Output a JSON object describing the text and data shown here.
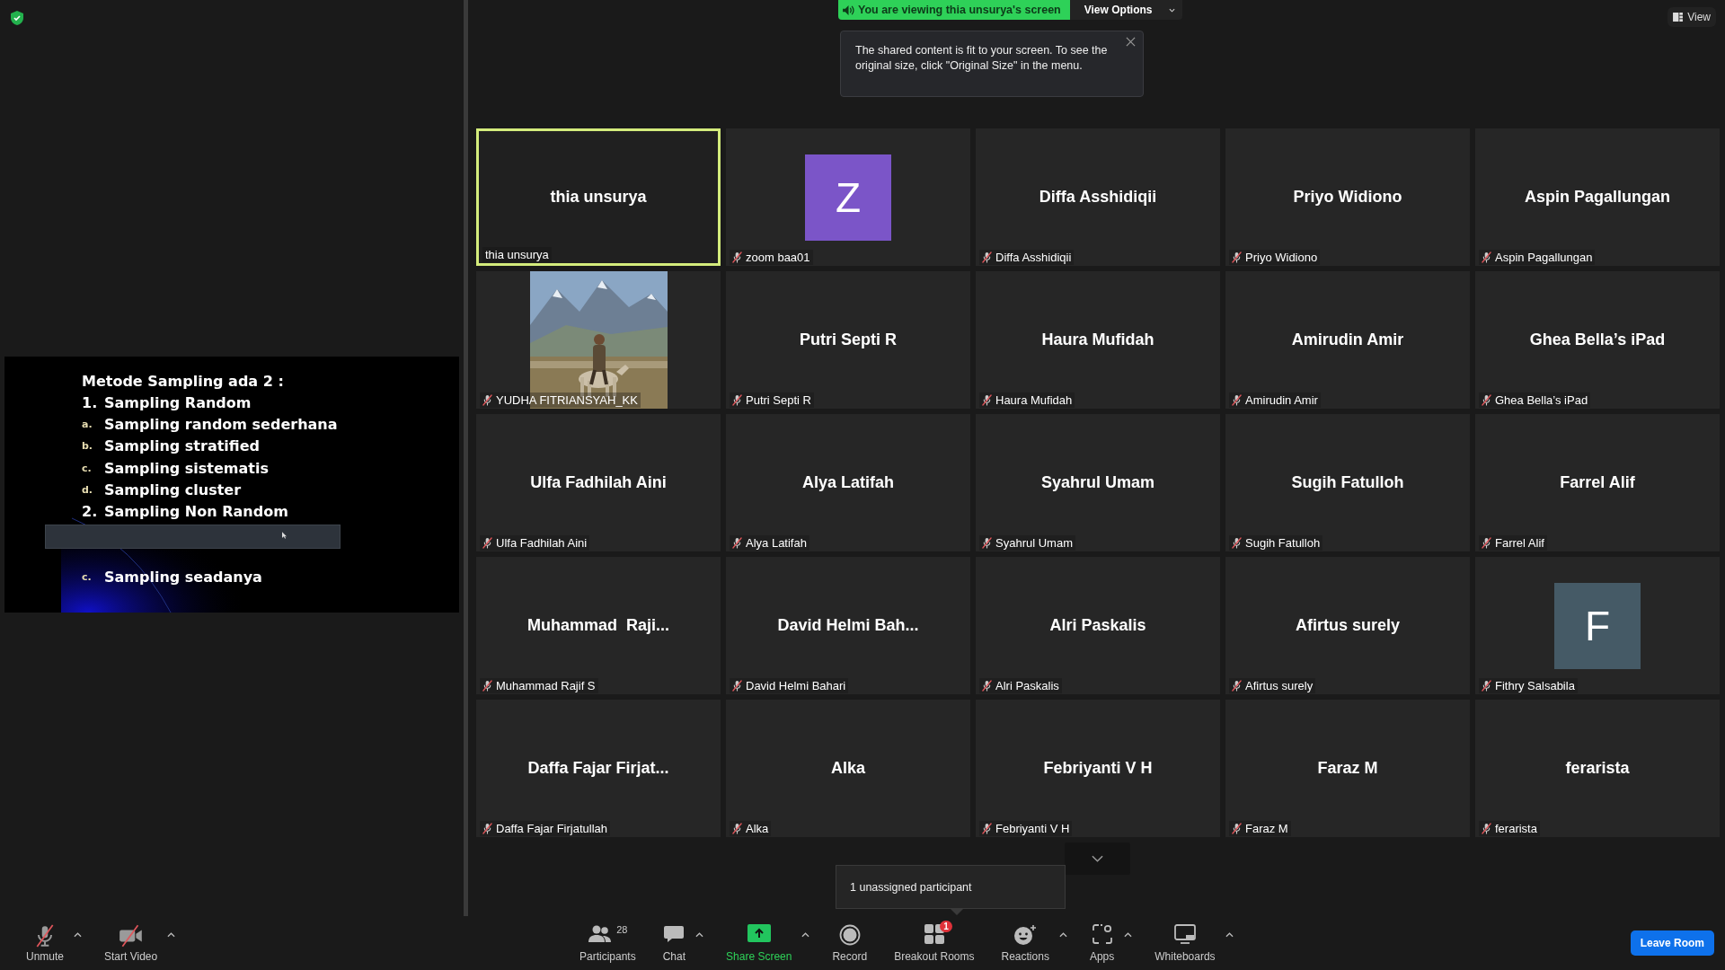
{
  "banner": {
    "text": "You are viewing thia unsurya's screen",
    "options_button": "View Options"
  },
  "tooltip": {
    "text": "The shared content is fit to your screen. To see the original size, click \"Original Size\" in the menu."
  },
  "view_button": {
    "label": "View"
  },
  "slide": {
    "title": "Metode Sampling ada 2 :",
    "items": [
      {
        "kind": "number",
        "marker": "1.",
        "text": "Sampling Random"
      },
      {
        "kind": "letter",
        "marker": "a.",
        "text": "Sampling random sederhana"
      },
      {
        "kind": "letter",
        "marker": "b.",
        "text": "Sampling stratified"
      },
      {
        "kind": "letter",
        "marker": "c.",
        "text": "Sampling sistematis"
      },
      {
        "kind": "letter",
        "marker": "d.",
        "text": "Sampling cluster"
      },
      {
        "kind": "number",
        "marker": "2.",
        "text": "Sampling Non Random"
      },
      {
        "kind": "covered"
      },
      {
        "kind": "letter",
        "marker": "c.",
        "text": "Sampling seadanya"
      }
    ]
  },
  "participants": [
    {
      "kind": "name",
      "display": "thia unsurya",
      "label": "thia unsurya",
      "muted": false,
      "speaking": true
    },
    {
      "kind": "avatar",
      "letter": "Z",
      "color": "#7b55c8",
      "label": "zoom baa01",
      "muted": true,
      "speaking": false
    },
    {
      "kind": "name",
      "display": "Diffa Asshidiqii",
      "label": "Diffa Asshidiqii",
      "muted": true,
      "speaking": false
    },
    {
      "kind": "name",
      "display": "Priyo Widiono",
      "label": "Priyo Widiono",
      "muted": true,
      "speaking": false
    },
    {
      "kind": "name",
      "display": "Aspin Pagallungan",
      "label": "Aspin Pagallungan",
      "muted": true,
      "speaking": false
    },
    {
      "kind": "picture",
      "label": "YUDHA FITRIANSYAH_KK",
      "muted": true,
      "speaking": false
    },
    {
      "kind": "name",
      "display": "Putri Septi R",
      "label": "Putri Septi R",
      "muted": true,
      "speaking": false
    },
    {
      "kind": "name",
      "display": "Haura Mufidah",
      "label": "Haura Mufidah",
      "muted": true,
      "speaking": false
    },
    {
      "kind": "name",
      "display": "Amirudin Amir",
      "label": "Amirudin Amir",
      "muted": true,
      "speaking": false
    },
    {
      "kind": "name",
      "display": "Ghea Bella’s iPad",
      "label": "Ghea Bella’s iPad",
      "muted": true,
      "speaking": false
    },
    {
      "kind": "name",
      "display": "Ulfa Fadhilah Aini",
      "label": "Ulfa Fadhilah Aini",
      "muted": true,
      "speaking": false
    },
    {
      "kind": "name",
      "display": "Alya Latifah",
      "label": "Alya Latifah",
      "muted": true,
      "speaking": false
    },
    {
      "kind": "name",
      "display": "Syahrul Umam",
      "label": "Syahrul Umam",
      "muted": true,
      "speaking": false
    },
    {
      "kind": "name",
      "display": "Sugih Fatulloh",
      "label": "Sugih Fatulloh",
      "muted": true,
      "speaking": false
    },
    {
      "kind": "name",
      "display": "Farrel Alif",
      "label": "Farrel Alif",
      "muted": true,
      "speaking": false
    },
    {
      "kind": "name",
      "display": "Muhammad  Raji...",
      "label": "Muhammad Rajif S",
      "muted": true,
      "speaking": false
    },
    {
      "kind": "name",
      "display": "David Helmi Bah...",
      "label": "David Helmi Bahari",
      "muted": true,
      "speaking": false
    },
    {
      "kind": "name",
      "display": "Alri Paskalis",
      "label": "Alri Paskalis",
      "muted": true,
      "speaking": false
    },
    {
      "kind": "name",
      "display": "Afirtus surely",
      "label": "Afirtus surely",
      "muted": true,
      "speaking": false
    },
    {
      "kind": "avatar",
      "letter": "F",
      "color": "#455a66",
      "label": "Fithry Salsabila",
      "muted": true,
      "speaking": false
    },
    {
      "kind": "name",
      "display": "Daffa Fajar Firjat...",
      "label": "Daffa Fajar Firjatullah",
      "muted": true,
      "speaking": false
    },
    {
      "kind": "name",
      "display": "Alka",
      "label": "Alka",
      "muted": true,
      "speaking": false
    },
    {
      "kind": "name",
      "display": "Febriyanti V H",
      "label": "Febriyanti V H",
      "muted": true,
      "speaking": false
    },
    {
      "kind": "name",
      "display": "Faraz M",
      "label": "Faraz M",
      "muted": true,
      "speaking": false
    },
    {
      "kind": "name",
      "display": "ferarista",
      "label": "ferarista",
      "muted": true,
      "speaking": false
    }
  ],
  "breakout_hint": {
    "text": "1 unassigned participant"
  },
  "toolbar": {
    "left": [
      {
        "kind": "mic-off",
        "label": "Unmute",
        "menu": true
      },
      {
        "kind": "video-off",
        "label": "Start Video",
        "menu": true
      }
    ],
    "center": [
      {
        "kind": "participants",
        "label": "Participants",
        "count": "28",
        "menu": false
      },
      {
        "kind": "chat",
        "label": "Chat",
        "menu": true
      },
      {
        "kind": "share",
        "label": "Share Screen",
        "menu": true
      },
      {
        "kind": "record",
        "label": "Record",
        "menu": false
      },
      {
        "kind": "breakout",
        "label": "Breakout Rooms",
        "badge": "1",
        "menu": false
      },
      {
        "kind": "reactions",
        "label": "Reactions",
        "menu": true
      },
      {
        "kind": "apps",
        "label": "Apps",
        "menu": true
      },
      {
        "kind": "whiteboards",
        "label": "Whiteboards",
        "menu": true
      }
    ],
    "leave_button": "Leave Room"
  }
}
